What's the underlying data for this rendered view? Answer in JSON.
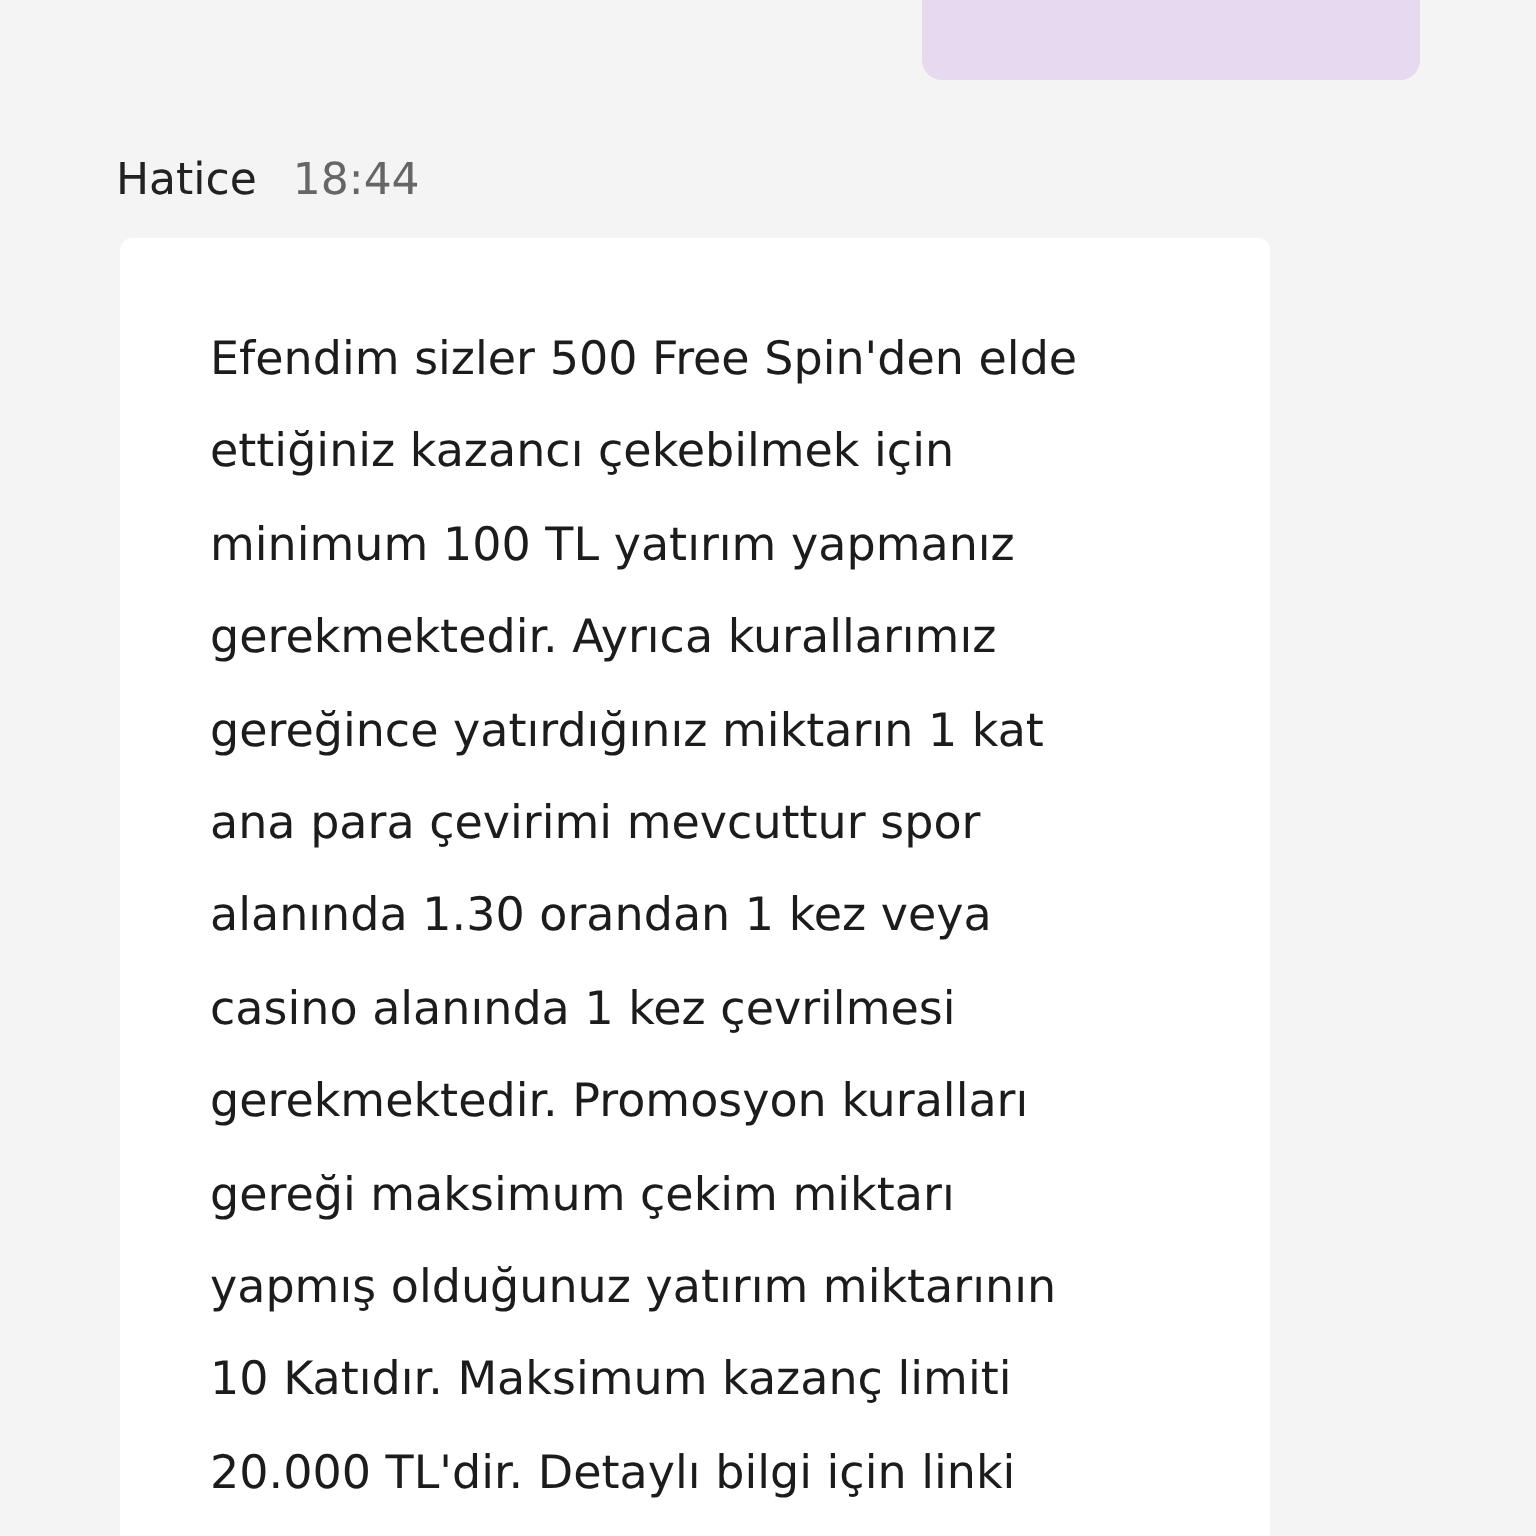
{
  "sender": {
    "name": "Hatice",
    "time": "18:44"
  },
  "message": {
    "lines": [
      "Efendim sizler 500 Free Spin'den elde",
      "ettiğiniz kazancı çekebilmek için",
      "minimum 100 TL yatırım yapmanız",
      "gerekmektedir. Ayrıca kurallarımız",
      "gereğince yatırdığınız miktarın 1 kat",
      "ana para çevirimi mevcuttur spor",
      "alanında 1.30 orandan 1 kez veya",
      "casino alanında 1 kez çevrilmesi",
      "gerekmektedir. Promosyon kuralları",
      "gereği maksimum çekim miktarı",
      "yapmış olduğunuz yatırım miktarının",
      "10 Katıdır. Maksimum kazanç limiti",
      "20.000 TL'dir. Detaylı bilgi için linki"
    ]
  }
}
